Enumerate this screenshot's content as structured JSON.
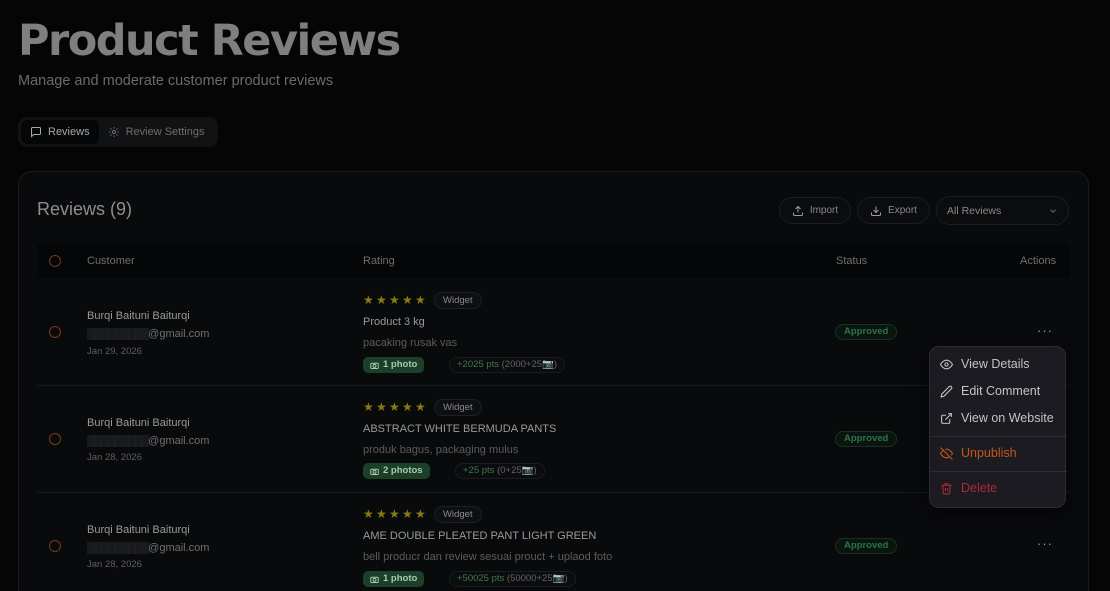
{
  "page": {
    "title": "Product Reviews",
    "subtitle": "Manage and moderate customer product reviews"
  },
  "tabs": [
    {
      "label": "Reviews",
      "icon": "message-square-icon",
      "active": true
    },
    {
      "label": "Review Settings",
      "icon": "gear-icon",
      "active": false
    }
  ],
  "card": {
    "title": "Reviews (9)",
    "import_label": "Import",
    "export_label": "Export",
    "filter": {
      "selected": "All Reviews"
    }
  },
  "table": {
    "headers": {
      "customer": "Customer",
      "rating": "Rating",
      "status": "Status",
      "actions": "Actions"
    },
    "rows": [
      {
        "name": "Burqi Baituni Baiturqi",
        "email": "@gmail.com",
        "date": "Jan 29, 2026",
        "stars": 5,
        "source": "Widget",
        "product": "Product 3 kg",
        "comment": "pacaking rusak vas",
        "photos": "1 photo",
        "pts": "+2025 pts",
        "pts_detail": "(2000+25📷)",
        "status": "Approved"
      },
      {
        "name": "Burqi Baituni Baiturqi",
        "email": "@gmail.com",
        "date": "Jan 28, 2026",
        "stars": 5,
        "source": "Widget",
        "product": "ABSTRACT WHITE BERMUDA PANTS",
        "comment": "produk bagus, packaging mulus",
        "photos": "2 photos",
        "pts": "+25 pts",
        "pts_detail": "(0+25📷)",
        "status": "Approved"
      },
      {
        "name": "Burqi Baituni Baiturqi",
        "email": "@gmail.com",
        "date": "Jan 28, 2026",
        "stars": 5,
        "source": "Widget",
        "product": "AME DOUBLE PLEATED PANT LIGHT GREEN",
        "comment": "bell producr dan review sesuai prouct + uplaod foto",
        "photos": "1 photo",
        "pts": "+50025 pts",
        "pts_detail": "(50000+25📷)",
        "status": "Approved"
      }
    ]
  },
  "menu": {
    "view_details": "View Details",
    "edit_comment": "Edit Comment",
    "view_website": "View on Website",
    "unpublish": "Unpublish",
    "delete": "Delete"
  },
  "colors": {
    "approved": "#2f7447",
    "unpublish": "#c5561c",
    "delete": "#b02a33",
    "star": "#8a7a12"
  }
}
